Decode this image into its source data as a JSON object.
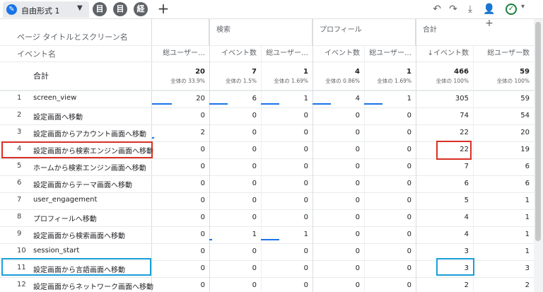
{
  "toolbar": {
    "tab_label": "自由形式 1",
    "round_tabs": [
      "目",
      "目",
      "経"
    ],
    "icons": [
      "undo-icon",
      "redo-icon",
      "download-icon",
      "share-user-icon",
      "check-icon"
    ]
  },
  "table": {
    "dimension_title": "ページ タイトルとスクリーン名",
    "dimension_subtitle": "イベント名",
    "total_label": "合計",
    "groups": [
      "",
      "検索",
      "プロフィール",
      "合計"
    ],
    "column_headers": [
      "総ユーザー…",
      "イベント数",
      "総ユーザー…",
      "イベント数",
      "総ユーザー…",
      "↓イベント数",
      "総ユーザー数"
    ],
    "totals": [
      {
        "value": "20",
        "pct": "全体の 33.9%"
      },
      {
        "value": "7",
        "pct": "全体の 1.5%"
      },
      {
        "value": "1",
        "pct": "全体の 1.69%"
      },
      {
        "value": "4",
        "pct": "全体の 0.86%"
      },
      {
        "value": "1",
        "pct": "全体の 1.69%"
      },
      {
        "value": "466",
        "pct": "全体の 100%"
      },
      {
        "value": "59",
        "pct": "全体の 100%"
      }
    ],
    "rows": [
      {
        "num": "1",
        "name": "screen_view",
        "values": [
          "20",
          "6",
          "1",
          "4",
          "1",
          "305",
          "59"
        ]
      },
      {
        "num": "2",
        "name": "設定画面へ移動",
        "values": [
          "0",
          "0",
          "0",
          "0",
          "0",
          "74",
          "54"
        ]
      },
      {
        "num": "3",
        "name": "設定画面からアカウント画面へ移動",
        "values": [
          "2",
          "0",
          "0",
          "0",
          "0",
          "22",
          "20"
        ]
      },
      {
        "num": "4",
        "name": "設定画面から検索エンジン画面へ移動",
        "values": [
          "0",
          "0",
          "0",
          "0",
          "0",
          "22",
          "19"
        ]
      },
      {
        "num": "5",
        "name": "ホームから検索エンジン画面へ移動",
        "values": [
          "0",
          "0",
          "0",
          "0",
          "0",
          "7",
          "6"
        ]
      },
      {
        "num": "6",
        "name": "設定画面からテーマ画面へ移動",
        "values": [
          "0",
          "0",
          "0",
          "0",
          "0",
          "6",
          "6"
        ]
      },
      {
        "num": "7",
        "name": "user_engagement",
        "values": [
          "0",
          "0",
          "0",
          "0",
          "0",
          "5",
          "1"
        ]
      },
      {
        "num": "8",
        "name": "プロフィールへ移動",
        "values": [
          "0",
          "0",
          "0",
          "0",
          "0",
          "4",
          "1"
        ]
      },
      {
        "num": "9",
        "name": "設定画面から検索画面へ移動",
        "values": [
          "0",
          "1",
          "1",
          "0",
          "0",
          "4",
          "1"
        ]
      },
      {
        "num": "10",
        "name": "session_start",
        "values": [
          "0",
          "0",
          "0",
          "0",
          "0",
          "3",
          "1"
        ]
      },
      {
        "num": "11",
        "name": "設定画面から言語画面へ移動",
        "values": [
          "0",
          "0",
          "0",
          "0",
          "0",
          "3",
          "3"
        ]
      },
      {
        "num": "12",
        "name": "設定画面からネットワーク画面へ移動",
        "values": [
          "0",
          "0",
          "0",
          "0",
          "0",
          "2",
          "2"
        ]
      }
    ]
  },
  "colors": {
    "highlight_red": "#d93025",
    "highlight_blue": "#1a9fd9",
    "bar_blue": "#1a73e8"
  }
}
